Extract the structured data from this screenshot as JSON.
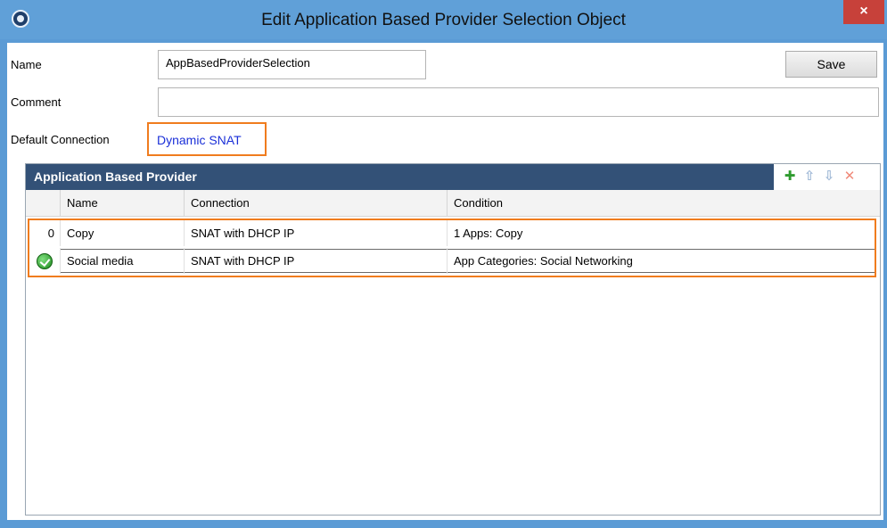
{
  "window": {
    "title": "Edit Application Based Provider Selection Object",
    "close_glyph": "×"
  },
  "form": {
    "name_label": "Name",
    "name_value": "AppBasedProviderSelection",
    "comment_label": "Comment",
    "comment_value": "",
    "default_connection_label": "Default Connection",
    "default_connection_value": "Dynamic SNAT",
    "save_label": "Save"
  },
  "grid": {
    "title": "Application Based Provider",
    "toolbar": {
      "add_glyph": "✚",
      "up_glyph": "⇧",
      "down_glyph": "⇩",
      "delete_glyph": "✕"
    },
    "columns": [
      "Name",
      "Connection",
      "Condition"
    ],
    "rows": [
      {
        "index": "0",
        "name": "Copy",
        "connection": "SNAT with DHCP IP",
        "condition": "1 Apps: Copy"
      },
      {
        "index": "",
        "name": "Social media",
        "connection": "SNAT with DHCP IP",
        "condition": "App Categories: Social Networking"
      }
    ]
  },
  "colors": {
    "titlebar": "#60a0d8",
    "grid_header": "#335177",
    "highlight": "#f07c1e",
    "link": "#1a2fd8",
    "close": "#c7413a"
  }
}
